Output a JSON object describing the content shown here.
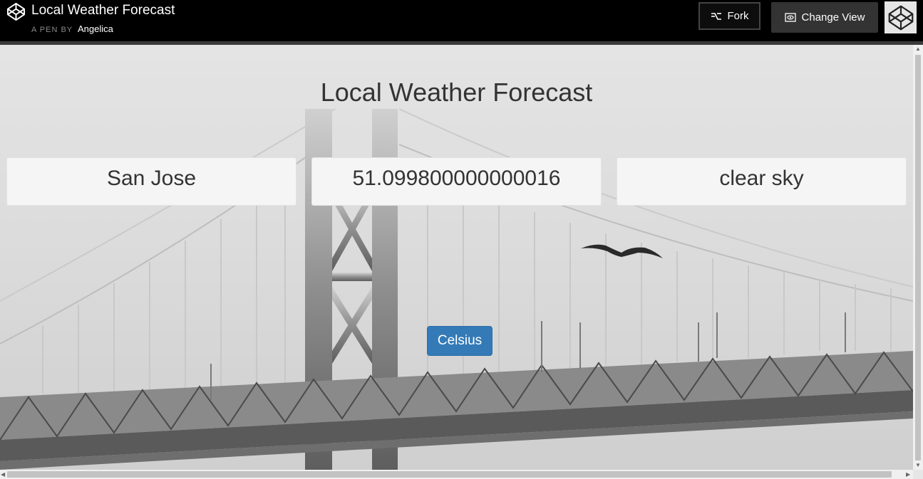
{
  "header": {
    "title": "Local Weather Forecast",
    "pen_by": "A PEN BY",
    "author": "Angelica",
    "fork_label": "Fork",
    "change_view_label": "Change View"
  },
  "app": {
    "heading": "Local Weather Forecast",
    "city": "San Jose",
    "temperature": "51.099800000000016",
    "description": "clear sky",
    "unit_button": "Celsius"
  },
  "colors": {
    "topbar": "#000000",
    "button_primary": "#337ab7",
    "card_bg": "#f5f5f5"
  },
  "icons": [
    "codepen-logo-icon",
    "fork-icon",
    "eye-icon",
    "codepen-avatar-icon"
  ]
}
